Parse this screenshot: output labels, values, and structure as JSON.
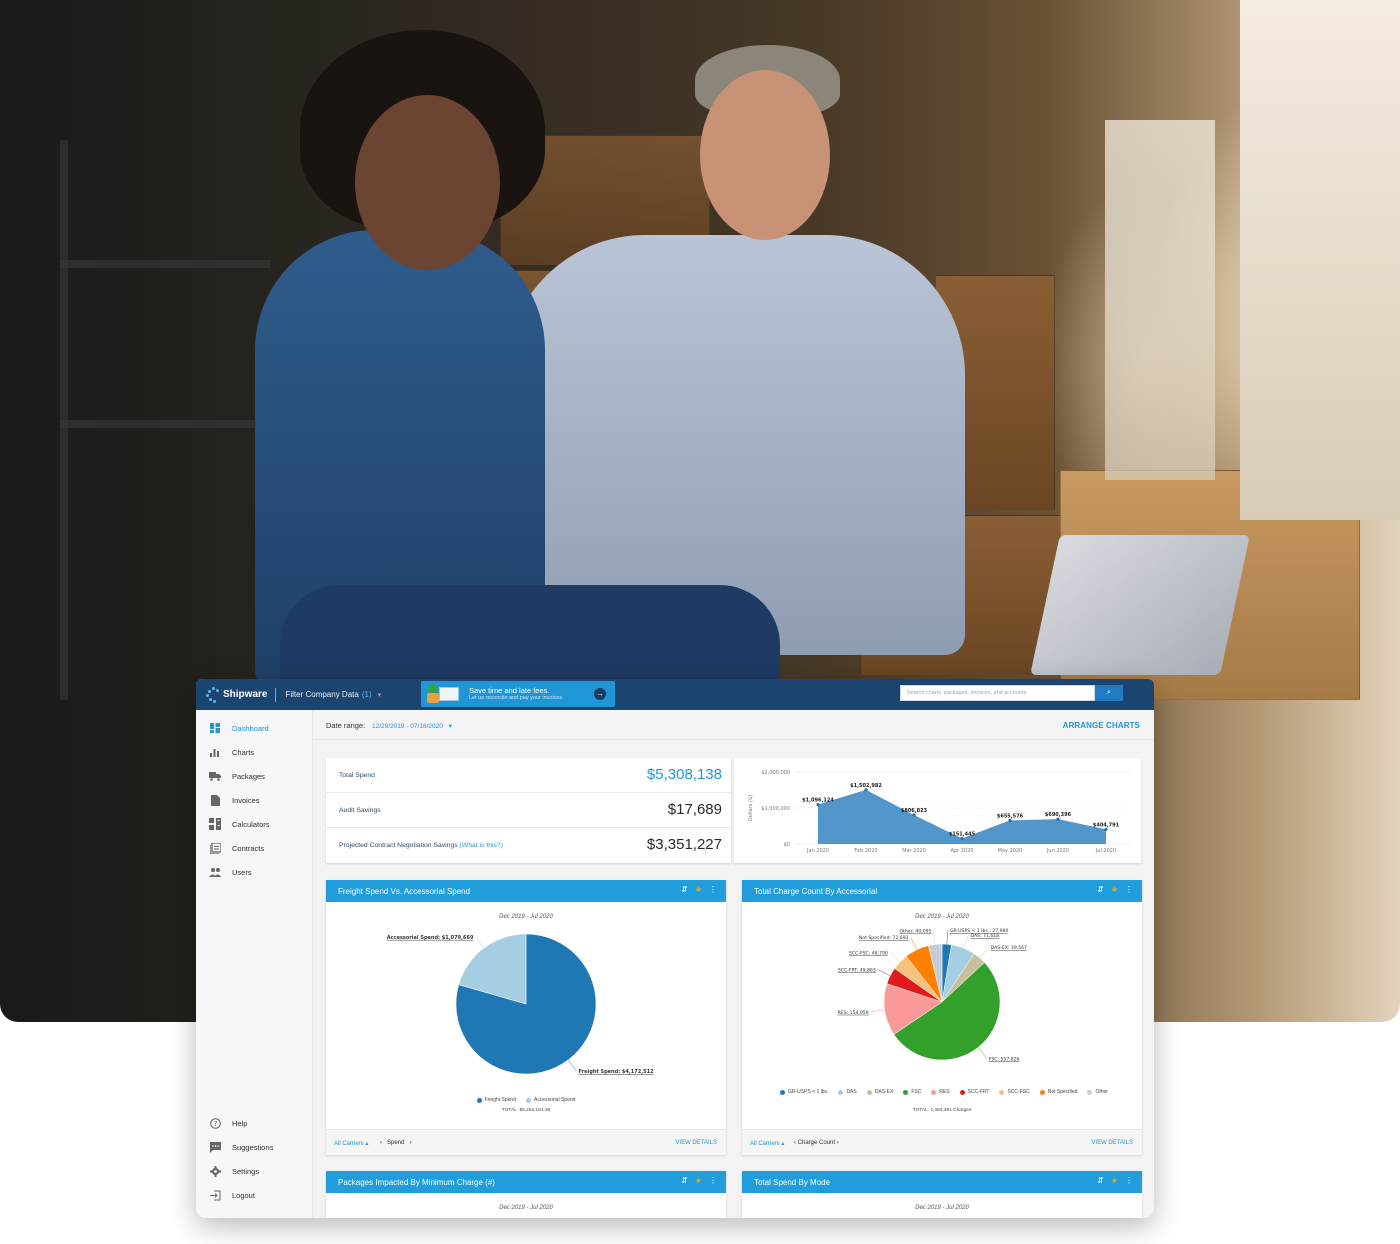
{
  "app": {
    "brand": "Shipware",
    "filter_label": "Filter Company Data",
    "filter_count": "(1)",
    "promo": {
      "title": "Save time and late fees.",
      "subtitle": "Let us reconcile and pay your invoices"
    },
    "search": {
      "placeholder": "Search charts, packages, invoices, and accounts",
      "value": ""
    }
  },
  "sidebar": {
    "items": [
      {
        "label": "Dashboard",
        "icon": "dashboard-icon",
        "active": true
      },
      {
        "label": "Charts",
        "icon": "bar-chart-icon"
      },
      {
        "label": "Packages",
        "icon": "truck-icon"
      },
      {
        "label": "Invoices",
        "icon": "document-icon"
      },
      {
        "label": "Calculators",
        "icon": "calculator-icon"
      },
      {
        "label": "Contracts",
        "icon": "contracts-icon"
      },
      {
        "label": "Users",
        "icon": "users-icon"
      }
    ],
    "bottom_items": [
      {
        "label": "Help",
        "icon": "help-icon"
      },
      {
        "label": "Suggestions",
        "icon": "chat-icon"
      },
      {
        "label": "Settings",
        "icon": "gear-icon"
      },
      {
        "label": "Logout",
        "icon": "logout-icon"
      }
    ]
  },
  "date_range": {
    "label": "Date range:",
    "value": "12/29/2019 - 07/18/2020",
    "arrange_label": "ARRANGE CHARTS"
  },
  "kpis": [
    {
      "label": "Total Spend",
      "value": "$5,308,138",
      "highlight": true
    },
    {
      "label": "Audit Savings",
      "value": "$17,689"
    },
    {
      "label": "Projected Contract Negotiation Savings",
      "link": "(What is this?)",
      "value": "$3,351,227"
    }
  ],
  "colors": {
    "topbar": "#1b4470",
    "accent": "#2196d6",
    "card_header": "#229ddb",
    "star": "#f7a21b"
  },
  "chart_data": [
    {
      "type": "area",
      "title": "",
      "ylabel": "Dollars ($)",
      "xlabel": "",
      "categories": [
        "Jan 2020",
        "Feb 2020",
        "Mar 2020",
        "Apr 2020",
        "May 2020",
        "Jun 2020",
        "Jul 2020"
      ],
      "values": [
        1096124,
        1502982,
        806823,
        151445,
        655576,
        690396,
        404791
      ],
      "data_labels": [
        "$1,096,124",
        "$1,502,982",
        "$806,823",
        "$151,445",
        "$655,576",
        "$690,396",
        "$404,791"
      ],
      "yticks": [
        "$0",
        "$1,000,000",
        "$2,000,000"
      ],
      "ylim": [
        0,
        2000000
      ],
      "grid": true,
      "color": "#4a90c8"
    },
    {
      "type": "pie",
      "title": "Freight Spend Vs. Accessorial Spend",
      "subtitle": "Dec 2019 - Jul 2020",
      "slices": [
        {
          "name": "Freight Spend",
          "value": 4172512,
          "label": "Freight Spend: $4,172,512",
          "color": "#1f77b4"
        },
        {
          "name": "Accessorial Spend",
          "value": 1079669,
          "label": "Accessorial Spend: $1,079,669",
          "color": "#a6cee3"
        }
      ],
      "total_label": "TOTAL",
      "total_value": "$5,252,181.39",
      "legend": "bottom",
      "footer": {
        "carriers": "All Carriers",
        "metric": "Spend",
        "view": "VIEW DETAILS"
      }
    },
    {
      "type": "pie",
      "title": "Total Charge Count By Accessorial",
      "subtitle": "Dec 2019 - Jul 2020",
      "slices": [
        {
          "name": "GR-USPS < 1 lbs.",
          "value": 27980,
          "label": "GR-USPS < 1 lbs.: 27,980",
          "color": "#1f77b4"
        },
        {
          "name": "DAS",
          "value": 71618,
          "label": "DAS: 71,618",
          "color": "#a6cee3"
        },
        {
          "name": "DAS-EX",
          "value": 39567,
          "label": "DAS-EX: 39,567",
          "color": "#c9bf9a"
        },
        {
          "name": "FSC",
          "value": 557826,
          "label": "FSC: 557,826",
          "color": "#33a02c"
        },
        {
          "name": "RES",
          "value": 154959,
          "label": "RES: 154,959",
          "color": "#fb9a99"
        },
        {
          "name": "SCC-FRT",
          "value": 49863,
          "label": "SCC-FRT: 49,863",
          "color": "#e31a1c"
        },
        {
          "name": "SCC-FSC",
          "value": 48790,
          "label": "SCC-FSC: 48,790",
          "color": "#f5c37f"
        },
        {
          "name": "Not Specified",
          "value": 72693,
          "label": "Not Specified: 72,693",
          "color": "#ff7f00"
        },
        {
          "name": "Other",
          "value": 40095,
          "label": "Other: 40,095",
          "color": "#c4cdd6"
        }
      ],
      "total_label": "TOTAL",
      "total_value": "1,063,391 Charges",
      "legend": "bottom",
      "footer": {
        "carriers": "All Carriers",
        "metric": "Charge Count",
        "view": "VIEW DETAILS"
      }
    }
  ],
  "cards": [
    {
      "title": "Freight Spend Vs. Accessorial Spend",
      "subtitle": "Dec 2019 - Jul 2020"
    },
    {
      "title": "Total Charge Count By Accessorial",
      "subtitle": "Dec 2019 - Jul 2020"
    },
    {
      "title": "Packages Impacted By Minimum Charge (#)",
      "subtitle": "Dec 2019 - Jul 2020"
    },
    {
      "title": "Total Spend By Mode",
      "subtitle": "Dec 2019 - Jul 2020"
    }
  ],
  "icons": {
    "sort": "⇵",
    "star": "★",
    "more": "⋮",
    "search": "⌕",
    "arrow": "→",
    "caret": "▾"
  }
}
